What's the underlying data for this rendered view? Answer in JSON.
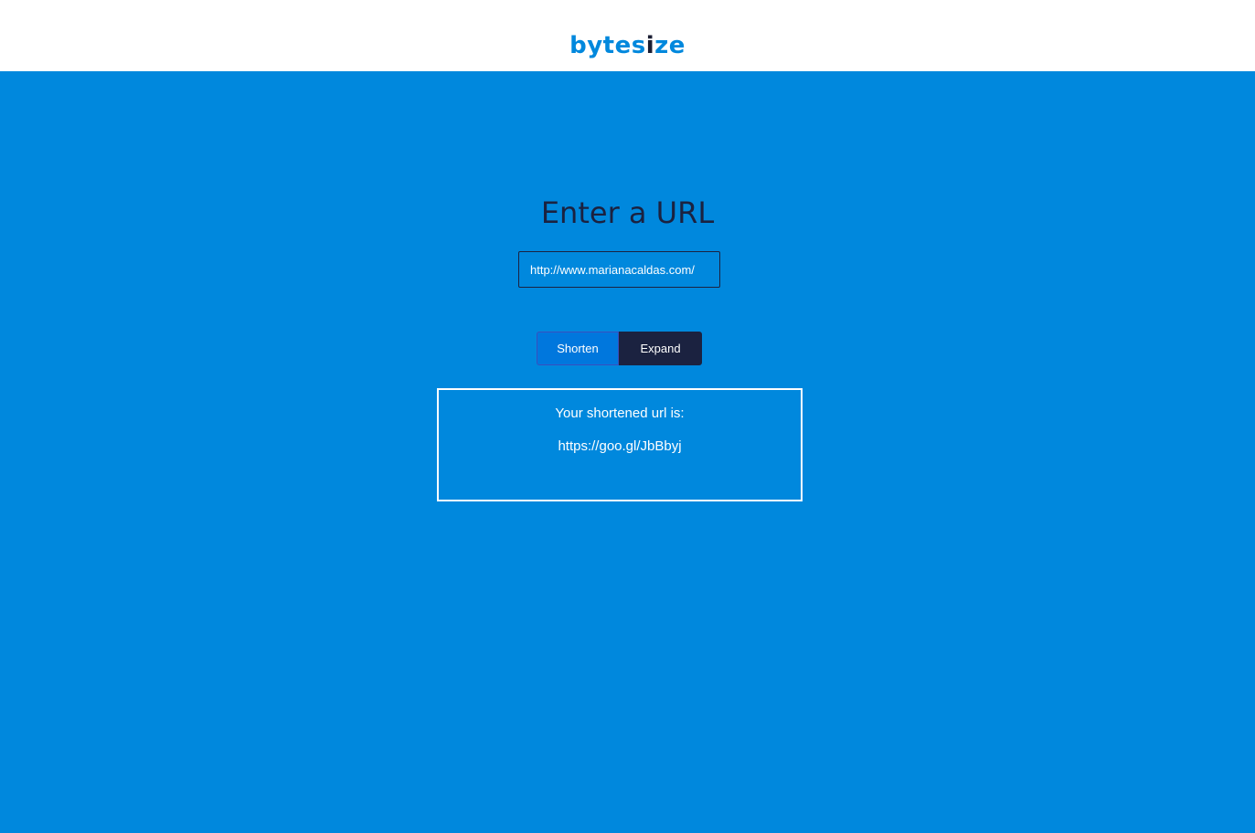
{
  "header": {
    "logo_part1": "bytes",
    "logo_accent": "i",
    "logo_part2": "ze"
  },
  "main": {
    "heading": "Enter a URL",
    "url_input": {
      "value": "http://www.marianacaldas.com/"
    },
    "buttons": {
      "shorten_label": "Shorten",
      "expand_label": "Expand"
    },
    "result": {
      "label": "Your shortened url is:",
      "url": "https://goo.gl/JbBbyj"
    }
  },
  "colors": {
    "brand_blue": "#0088dd",
    "navy": "#1b2240",
    "white": "#ffffff"
  }
}
